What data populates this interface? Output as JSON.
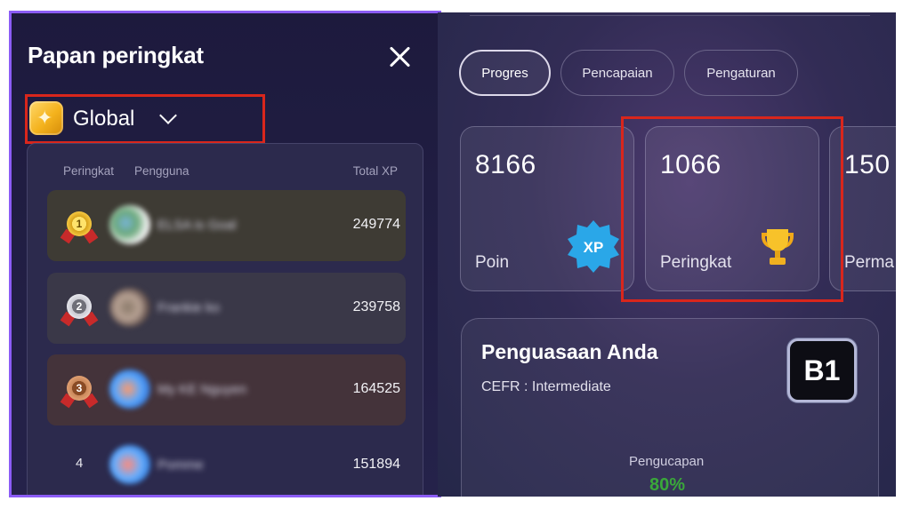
{
  "leaderboard": {
    "title": "Papan peringkat",
    "scope": {
      "label": "Global",
      "icon": "star-badge-icon"
    },
    "columns": {
      "rank": "Peringkat",
      "user": "Pengguna",
      "xp": "Total XP"
    },
    "rows": [
      {
        "rank": "1",
        "medal": "gold",
        "name": "ELSA is Goal",
        "xp": "249774"
      },
      {
        "rank": "2",
        "medal": "silver",
        "name": "Frankie ko",
        "xp": "239758"
      },
      {
        "rank": "3",
        "medal": "bronze",
        "name": "My KE Nguyen",
        "xp": "164525"
      },
      {
        "rank": "4",
        "medal": "",
        "name": "Pomme",
        "xp": "151894"
      }
    ]
  },
  "profile": {
    "tabs": [
      {
        "label": "Progres",
        "active": true
      },
      {
        "label": "Pencapaian",
        "active": false
      },
      {
        "label": "Pengaturan",
        "active": false
      }
    ],
    "stats": [
      {
        "value": "8166",
        "label": "Poin",
        "icon": "xp-badge-icon"
      },
      {
        "value": "1066",
        "label": "Peringkat",
        "icon": "trophy-icon"
      },
      {
        "value": "150",
        "label": "Perma",
        "icon": ""
      }
    ],
    "mastery": {
      "title": "Penguasaan Anda",
      "subtitle": "CEFR : Intermediate",
      "level": "B1",
      "pronunciation_label": "Pengucapan",
      "pronunciation_value": "80%"
    }
  },
  "colors": {
    "highlight": "#d9261c",
    "panel_border": "#8b5cf6",
    "xp_badge": "#2aa7e8",
    "trophy": "#f5b820",
    "pronunciation": "#3aa83a"
  }
}
